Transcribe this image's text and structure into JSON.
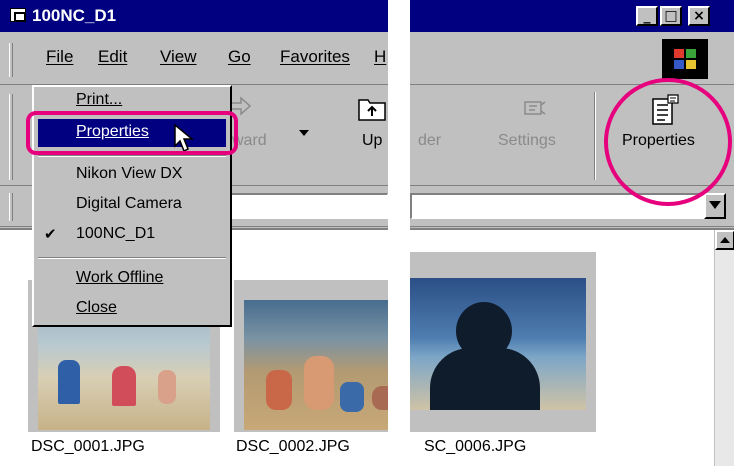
{
  "window": {
    "title": "100NC_D1",
    "minimize_glyph": "_",
    "maximize_glyph": "□",
    "close_glyph": "×"
  },
  "menubar": {
    "items": [
      "File",
      "Edit",
      "View",
      "Go",
      "Favorites",
      "H"
    ]
  },
  "toolbar": {
    "forward_label": "ward",
    "up_label": "Up",
    "folders_label": "der",
    "settings_label": "Settings",
    "properties_label": "Properties"
  },
  "file_menu": {
    "items": [
      {
        "label": "Print..."
      },
      {
        "label": "Properties",
        "highlighted": true
      },
      {
        "label": "Nikon View DX"
      },
      {
        "label": "Digital Camera"
      },
      {
        "label": "100NC_D1",
        "checked": true
      },
      {
        "label": "Work Offline"
      },
      {
        "label": "Close"
      }
    ],
    "check_glyph": "✔"
  },
  "files": [
    {
      "name": "DSC_0001.JPG"
    },
    {
      "name": "DSC_0002.JPG"
    },
    {
      "name": "SC_0006.JPG"
    }
  ],
  "colors": {
    "highlight_ring": "#e6007e",
    "titlebar": "#000080",
    "menu_selection": "#000080"
  },
  "icons": [
    "window-icon",
    "minimize-icon",
    "maximize-icon",
    "close-icon",
    "windows-logo-icon",
    "forward-icon",
    "dropdown-arrow-icon",
    "up-folder-icon",
    "settings-icon",
    "properties-icon",
    "mouse-cursor-icon",
    "scroll-up-icon"
  ]
}
